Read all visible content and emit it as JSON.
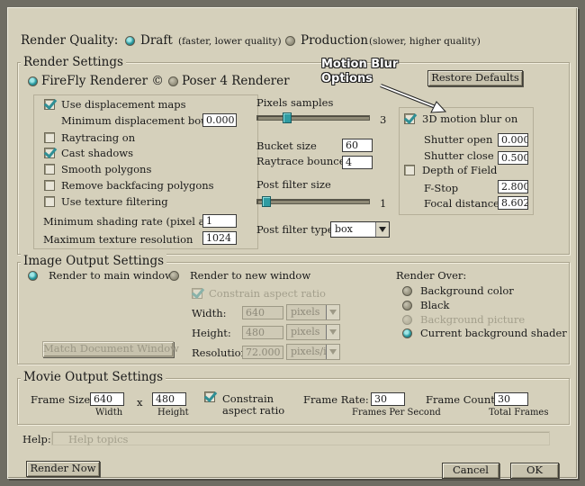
{
  "render_quality": {
    "label": "Render Quality:",
    "draft": "Draft",
    "draft_note": "(faster, lower quality)",
    "production": "Production",
    "production_note": "(slower, higher quality)",
    "selected": "draft"
  },
  "render_settings": {
    "legend": "Render Settings",
    "firefly": "FireFly Renderer ©",
    "poser4": "Poser 4 Renderer",
    "restore_defaults": "Restore Defaults",
    "use_displacement": "Use displacement maps",
    "min_disp_bounds_label": "Minimum displacement bounds",
    "min_disp_bounds": "0.000",
    "raytracing": "Raytracing on",
    "cast_shadows": "Cast shadows",
    "smooth_polygons": "Smooth polygons",
    "remove_backfacing": "Remove backfacing polygons",
    "texture_filtering": "Use texture filtering",
    "min_shading_label": "Minimum shading rate (pixel area)",
    "min_shading": "1",
    "max_texture_label": "Maximum texture resolution",
    "max_texture": "1024",
    "pixel_samples_label": "Pixels samples",
    "pixel_samples": "3",
    "pixel_samples_level": 0.25,
    "bucket_size_label": "Bucket size",
    "bucket_size": "60",
    "raytrace_bounces_label": "Raytrace bounces",
    "raytrace_bounces": "4",
    "post_filter_size_label": "Post filter size",
    "post_filter_size": "1",
    "post_filter_size_level": 0.05,
    "post_filter_type_label": "Post filter type",
    "post_filter_type": "box",
    "motion_blur": "3D motion blur on",
    "shutter_open_label": "Shutter open",
    "shutter_open": "0.000",
    "shutter_close_label": "Shutter close",
    "shutter_close": "0.500",
    "dof": "Depth of Field",
    "fstop_label": "F-Stop",
    "fstop": "2.800",
    "focal_label": "Focal distance",
    "focal": "8.602"
  },
  "callout": {
    "line1": "Motion Blur",
    "line2": "Options"
  },
  "image_output": {
    "legend": "Image Output Settings",
    "main_window": "Render to main window",
    "new_window": "Render to new window",
    "constrain": "Constrain aspect ratio",
    "width_label": "Width:",
    "width": "640",
    "width_unit": "pixels",
    "height_label": "Height:",
    "height": "480",
    "height_unit": "pixels",
    "resolution_label": "Resolution:",
    "resolution": "72.000",
    "resolution_unit": "pixels/in",
    "match_doc": "Match Document Window",
    "render_over": "Render Over:",
    "bg_color": "Background color",
    "black": "Black",
    "bg_picture": "Background picture",
    "bg_shader": "Current background shader"
  },
  "movie_output": {
    "legend": "Movie Output Settings",
    "frame_size_label": "Frame Size:",
    "width": "640",
    "x": "x",
    "height": "480",
    "width_label": "Width",
    "height_label": "Height",
    "constrain_line1": "Constrain",
    "constrain_line2": "aspect ratio",
    "frame_rate_label": "Frame Rate:",
    "frame_rate": "30",
    "fps_label": "Frames Per Second",
    "frame_count_label": "Frame Count:",
    "frame_count": "30",
    "total_frames_label": "Total Frames"
  },
  "help": {
    "label": "Help:",
    "text": "Help topics"
  },
  "buttons": {
    "render_now": "Render Now",
    "cancel": "Cancel",
    "ok": "OK"
  },
  "colors": {
    "panel": "#d5d0bb",
    "accent": "#2f9ca2"
  }
}
